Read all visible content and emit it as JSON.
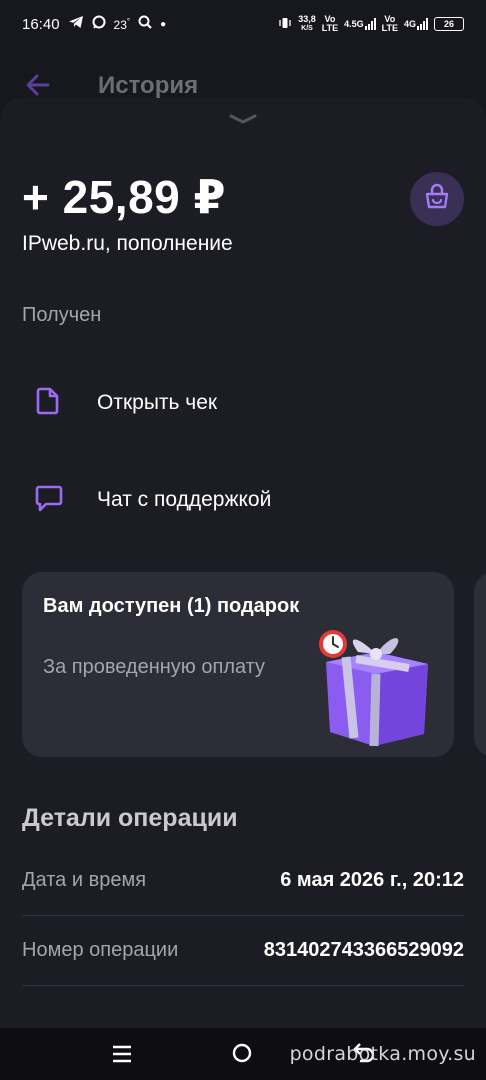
{
  "statusbar": {
    "time": "16:40",
    "temp": "23",
    "deg": "°",
    "speed_value": "33,8",
    "speed_unit": "K/S",
    "net1_top": "Vo",
    "net1_bottom": "LTE",
    "net2_top": "4.5G",
    "net3_top": "Vo",
    "net3_bottom": "LTE",
    "net4_top": "4G",
    "battery": "26"
  },
  "header": {
    "title": "История"
  },
  "transaction": {
    "amount": "+ 25,89 ₽",
    "merchant": "IPweb.ru, пополнение",
    "status": "Получен"
  },
  "actions": {
    "receipt_label": "Открыть чек",
    "chat_label": "Чат с поддержкой"
  },
  "gift": {
    "title": "Вам доступен (1) подарок",
    "subtitle": "За проведенную оплату"
  },
  "details": {
    "title": "Детали операции",
    "rows": [
      {
        "label": "Дата и время",
        "value": "6 мая 2026 г., 20:12"
      },
      {
        "label": "Номер операции",
        "value": "831402743366529092"
      }
    ]
  },
  "watermark": "podrabotka.moy.su",
  "colors": {
    "background": "#17171e",
    "sheet": "#1c1c24",
    "card": "#2d2d38",
    "accent": "#8b5cf6",
    "muted_text": "#a4a4ac"
  }
}
